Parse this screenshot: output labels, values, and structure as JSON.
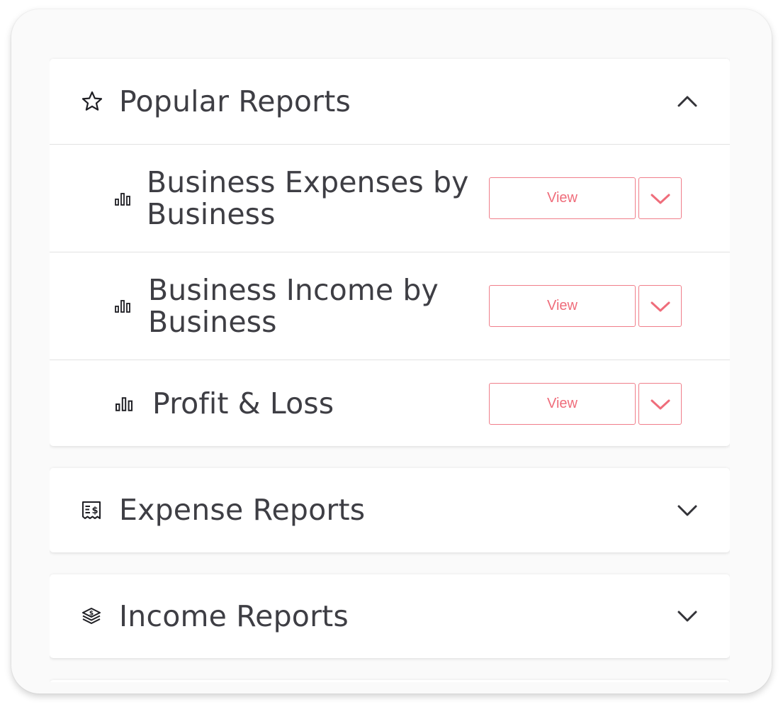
{
  "sections": {
    "popular": {
      "title": "Popular Reports",
      "icon": "star-icon",
      "expanded": true,
      "reports": [
        {
          "title": "Business Expenses by Business",
          "icon": "bar-chart-icon",
          "view_label": "View"
        },
        {
          "title": "Business Income by Business",
          "icon": "bar-chart-icon",
          "view_label": "View"
        },
        {
          "title": "Profit & Loss",
          "icon": "bar-chart-icon",
          "view_label": "View"
        }
      ]
    },
    "expense": {
      "title": "Expense Reports",
      "icon": "receipt-dollar-icon",
      "expanded": false
    },
    "income": {
      "title": "Income Reports",
      "icon": "money-stack-icon",
      "expanded": false
    }
  },
  "colors": {
    "accent": "#ef6d7b",
    "text": "#3e3e44",
    "divider": "#e2e2e2"
  }
}
